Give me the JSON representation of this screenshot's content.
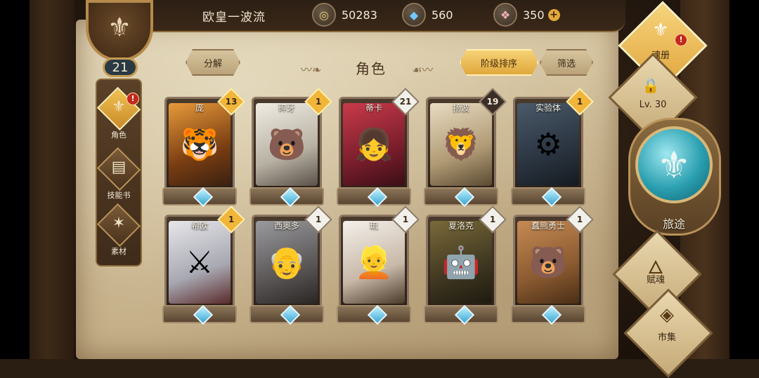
{
  "player": {
    "name": "欧皇一波流",
    "level": "21"
  },
  "resources": [
    {
      "icon": "gold-coin-icon",
      "value": "50283"
    },
    {
      "icon": "blue-crystal-icon",
      "value": "560"
    },
    {
      "icon": "pink-gem-icon",
      "value": "350"
    }
  ],
  "side_tabs": [
    {
      "label": "角色",
      "icon": "character-crest-icon",
      "active": true,
      "alert": "!"
    },
    {
      "label": "技能书",
      "icon": "skill-book-icon",
      "active": false
    },
    {
      "label": "素材",
      "icon": "material-icon",
      "active": false
    }
  ],
  "header": {
    "title": "角色",
    "decompose_label": "分解",
    "sort_label": "阶级排序",
    "filter_label": "筛选"
  },
  "cards": [
    {
      "name": "庞",
      "count": "13",
      "badge": "gold",
      "portrait": "tiger-portrait"
    },
    {
      "name": "碎牙",
      "count": "1",
      "badge": "gold",
      "portrait": "polar-bear-portrait"
    },
    {
      "name": "蒂卡",
      "count": "21",
      "badge": "white",
      "portrait": "red-hair-girl-portrait"
    },
    {
      "name": "扬波",
      "count": "19",
      "badge": "dark",
      "portrait": "white-lion-portrait"
    },
    {
      "name": "实验体",
      "count": "1",
      "badge": "gold",
      "portrait": "mech-creature-portrait"
    },
    {
      "name": "希欧",
      "count": "1",
      "badge": "gold",
      "portrait": "silver-knight-portrait"
    },
    {
      "name": "西奥多",
      "count": "1",
      "badge": "white",
      "portrait": "old-man-portrait"
    },
    {
      "name": "琉",
      "count": "1",
      "badge": "white",
      "portrait": "white-hair-girl-portrait"
    },
    {
      "name": "夏洛克",
      "count": "1",
      "badge": "white",
      "portrait": "diving-helmet-portrait"
    },
    {
      "name": "蠢熊勇士",
      "count": "1",
      "badge": "white",
      "portrait": "brown-bear-portrait"
    }
  ],
  "right_menu": {
    "soul_book_label": "魂册",
    "locked_label": "Lv. 30",
    "journey_label": "旅途",
    "endow_label": "赋魂",
    "market_label": "市集"
  },
  "colors": {
    "accent_gold": "#f1b53a",
    "parchment": "#d2c09c",
    "gem_blue": "#3aa7d4"
  }
}
